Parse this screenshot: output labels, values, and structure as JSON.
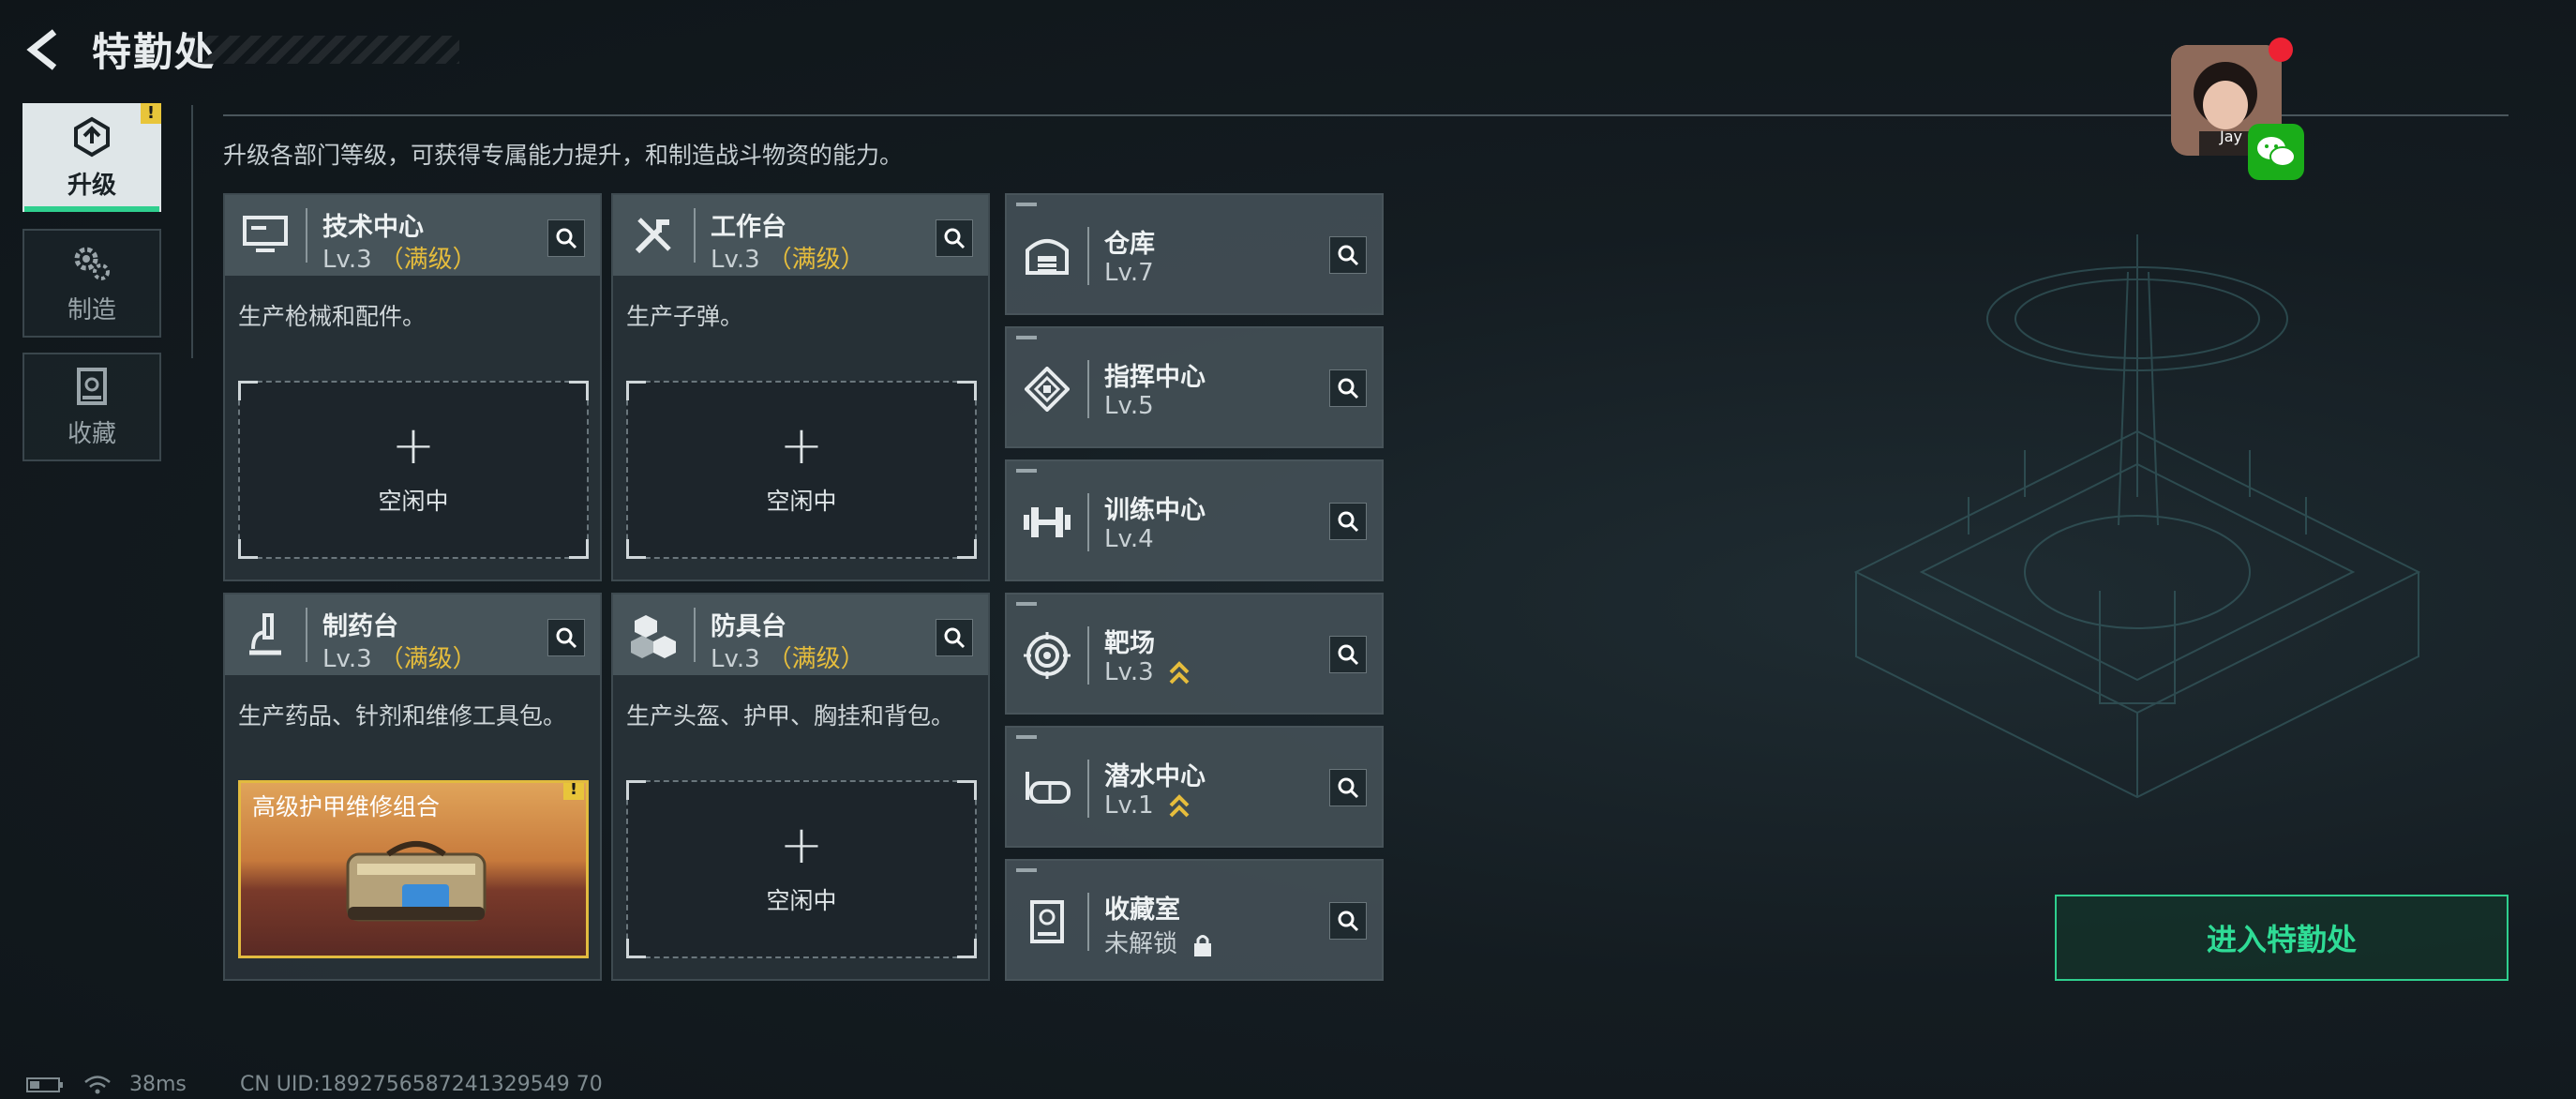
{
  "header": {
    "title": "特勤处"
  },
  "nav": {
    "items": [
      {
        "label": "升级",
        "icon": "upgrade-icon",
        "active": true,
        "warn": "!"
      },
      {
        "label": "制造",
        "icon": "gears-icon",
        "active": false
      },
      {
        "label": "收藏",
        "icon": "collection-icon",
        "active": false
      }
    ]
  },
  "description": "升级各部门等级，可获得专属能力提升，和制造战斗物资的能力。",
  "facilities": [
    {
      "name": "技术中心",
      "level": "Lv.3",
      "status": "（满级）",
      "desc": "生产枪械和配件。",
      "slot": {
        "plus": "+",
        "label": "空闲中"
      }
    },
    {
      "name": "工作台",
      "level": "Lv.3",
      "status": "（满级）",
      "desc": "生产子弹。",
      "slot": {
        "plus": "+",
        "label": "空闲中"
      }
    },
    {
      "name": "制药台",
      "level": "Lv.3",
      "status": "（满级）",
      "desc": "生产药品、针剂和维修工具包。",
      "item": {
        "name": "高级护甲维修组合",
        "warn": "!"
      }
    },
    {
      "name": "防具台",
      "level": "Lv.3",
      "status": "（满级）",
      "desc": "生产头盔、护甲、胸挂和背包。",
      "slot": {
        "plus": "+",
        "label": "空闲中"
      }
    }
  ],
  "rooms": [
    {
      "name": "仓库",
      "level": "Lv.7",
      "icon": "warehouse-icon"
    },
    {
      "name": "指挥中心",
      "level": "Lv.5",
      "icon": "command-icon"
    },
    {
      "name": "训练中心",
      "level": "Lv.4",
      "icon": "dumbbell-icon",
      "up": false
    },
    {
      "name": "靶场",
      "level": "Lv.3",
      "icon": "target-icon",
      "up": true
    },
    {
      "name": "潜水中心",
      "level": "Lv.1",
      "icon": "dive-mask-icon",
      "up": true
    },
    {
      "name": "收藏室",
      "level": "未解锁",
      "icon": "collection-icon",
      "locked": true
    }
  ],
  "enter_button": "进入特勤处",
  "status_bar": {
    "ping": "38ms",
    "uid": "CN UID:1892756587241329549 70"
  },
  "profile": {
    "name": "Jay"
  },
  "colors": {
    "accent": "#2fcf8e",
    "gold": "#e6bd3c",
    "warn": "#e8c53a"
  }
}
